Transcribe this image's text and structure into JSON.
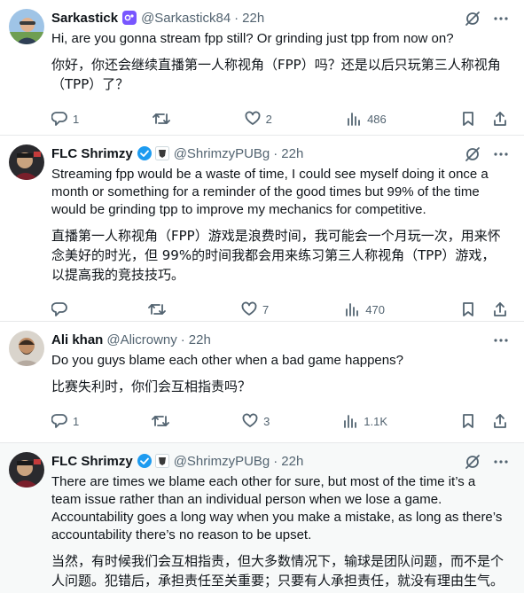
{
  "tweets": [
    {
      "name": "Sarkastick",
      "handle": "@Sarkastick84",
      "time": "22h",
      "text": "Hi, are you gonna stream fpp still? Or grinding just tpp from now on?",
      "translation": "你好，你还会继续直播第一人称视角（FPP）吗？还是以后只玩第三人称视角（TPP）了？",
      "replies": "1",
      "retweets": "",
      "likes": "2",
      "views": "486"
    },
    {
      "name": "FLC Shrimzy",
      "handle": "@ShrimzyPUBg",
      "time": "22h",
      "text": "Streaming fpp would be a waste of time, I could see myself doing it once a month or something for a reminder of the good times but 99% of the time would be grinding tpp to improve my mechanics for competitive.",
      "translation": "直播第一人称视角（FPP）游戏是浪费时间，我可能会一个月玩一次，用来怀念美好的时光，但 99%的时间我都会用来练习第三人称视角（TPP）游戏，以提高我的竞技技巧。",
      "replies": "",
      "retweets": "",
      "likes": "7",
      "views": "470"
    },
    {
      "name": "Ali khan",
      "handle": "@Alicrowny",
      "time": "22h",
      "text": "Do you guys blame each other when a bad game happens?",
      "translation": "比赛失利时，你们会互相指责吗？",
      "replies": "1",
      "retweets": "",
      "likes": "3",
      "views": "1.1K"
    },
    {
      "name": "FLC Shrimzy",
      "handle": "@ShrimzyPUBg",
      "time": "22h",
      "text": "There are times we blame each other for sure, but most of the time it’s a team issue rather than an individual person when we lose a game. Accountability goes a long way when you make a mistake, as long as there’s accountability there’s no reason to be upset.",
      "translation": "当然，有时候我们会互相指责，但大多数情况下，输球是团队问题，而不是个人问题。犯错后，承担责任至关重要；只要有人承担责任，就没有理由生气。"
    }
  ],
  "colors": {
    "text": "#0f1419",
    "muted": "#536471",
    "verified": "#1d9bf0",
    "subscriber_badge": "#7856ff",
    "divider": "#e7e9ea",
    "shaded_bg": "#f7f9f9"
  },
  "icons": [
    "grok-icon",
    "more-icon",
    "reply-icon",
    "retweet-icon",
    "like-icon",
    "views-icon",
    "bookmark-icon",
    "share-icon",
    "verified-icon",
    "affiliate-badge-icon",
    "subscriber-badge-icon"
  ]
}
